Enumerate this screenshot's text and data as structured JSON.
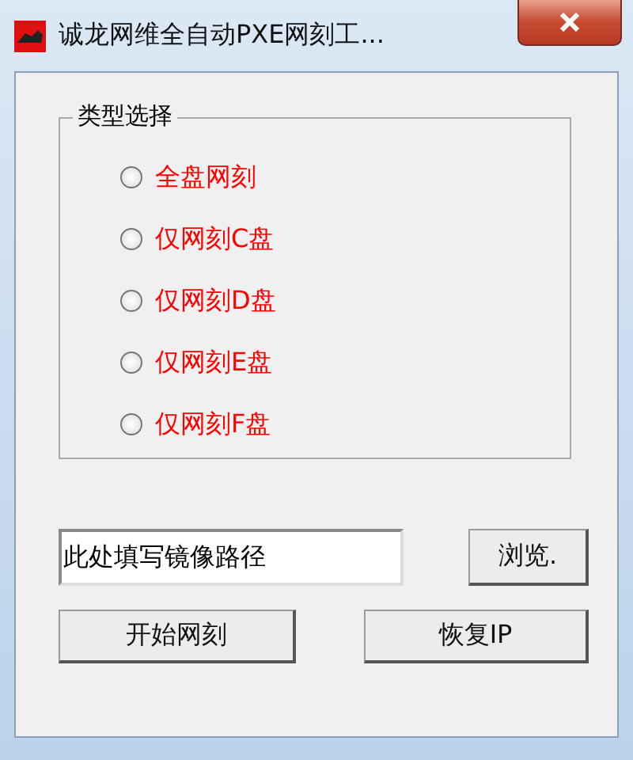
{
  "window": {
    "title": "诚龙网维全自动PXE网刻工..."
  },
  "group": {
    "title": "类型选择",
    "options": [
      {
        "label": "全盘网刻",
        "selected": false
      },
      {
        "label": "仅网刻C盘",
        "selected": false
      },
      {
        "label": "仅网刻D盘",
        "selected": false
      },
      {
        "label": "仅网刻E盘",
        "selected": false
      },
      {
        "label": "仅网刻F盘",
        "selected": false
      }
    ]
  },
  "path_field": {
    "value": "此处填写镜像路径"
  },
  "browse_button": "浏览.",
  "buttons": [
    "开始网刻",
    "恢复IP"
  ]
}
